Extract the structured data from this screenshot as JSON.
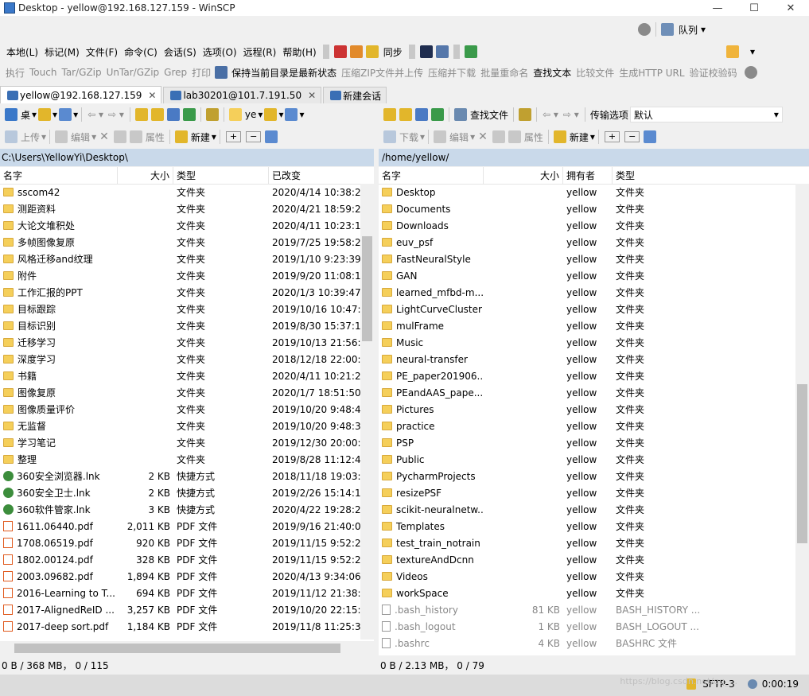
{
  "window": {
    "title": "Desktop - yellow@192.168.127.159 - WinSCP",
    "controls": [
      "—",
      "☐",
      "✕"
    ]
  },
  "top_toolbar": {
    "queue_label": "队列"
  },
  "menubar": {
    "items": [
      "本地(L)",
      "标记(M)",
      "文件(F)",
      "命令(C)",
      "会话(S)",
      "选项(O)",
      "远程(R)",
      "帮助(H)"
    ],
    "sync_label": "同步"
  },
  "commandbar": {
    "disabled_left": [
      "执行",
      "Touch",
      "Tar/GZip",
      "UnTar/GZip",
      "Grep",
      "打印"
    ],
    "keep_remote": "保持当前目录是最新状态",
    "disabled_mid": [
      "压缩ZIP文件并上传",
      "压缩并下载",
      "批量重命名"
    ],
    "find_text": "查找文本",
    "disabled_right": [
      "比较文件",
      "生成HTTP URL",
      "验证校验码"
    ]
  },
  "tabs": [
    {
      "label": "yellow@192.168.127.159",
      "close": "✕",
      "active": true
    },
    {
      "label": "lab30201@101.7.191.50",
      "close": "✕",
      "active": false
    },
    {
      "label": "新建会话",
      "close": "",
      "active": false
    }
  ],
  "local_toolbar": {
    "drive": "桌",
    "folder": "ye"
  },
  "remote_toolbar": {
    "find_files": "查找文件",
    "transfer_options": "传输选项",
    "transfer_value": "默认"
  },
  "local_actions": {
    "upload": "上传",
    "edit": "编辑",
    "props": "属性",
    "new": "新建"
  },
  "remote_actions": {
    "download": "下载",
    "edit": "编辑",
    "props": "属性",
    "new": "新建"
  },
  "local": {
    "path": "C:\\Users\\YellowYi\\Desktop\\",
    "headers": {
      "name": "名字",
      "size": "大小",
      "type": "类型",
      "modified": "已改变"
    },
    "rows": [
      {
        "icon": "folder",
        "name": "sscom42",
        "size": "",
        "type": "文件夹",
        "modified": "2020/4/14  10:38:2"
      },
      {
        "icon": "folder",
        "name": "测距资料",
        "size": "",
        "type": "文件夹",
        "modified": "2020/4/21  18:59:2"
      },
      {
        "icon": "folder",
        "name": "大论文堆积处",
        "size": "",
        "type": "文件夹",
        "modified": "2020/4/11  10:23:1"
      },
      {
        "icon": "folder",
        "name": "多帧图像复原",
        "size": "",
        "type": "文件夹",
        "modified": "2019/7/25  19:58:2"
      },
      {
        "icon": "folder",
        "name": "风格迁移and纹理",
        "size": "",
        "type": "文件夹",
        "modified": "2019/1/10  9:23:39"
      },
      {
        "icon": "folder",
        "name": "附件",
        "size": "",
        "type": "文件夹",
        "modified": "2019/9/20  11:08:1"
      },
      {
        "icon": "folder",
        "name": "工作汇报的PPT",
        "size": "",
        "type": "文件夹",
        "modified": "2020/1/3  10:39:47"
      },
      {
        "icon": "folder",
        "name": "目标跟踪",
        "size": "",
        "type": "文件夹",
        "modified": "2019/10/16  10:47:"
      },
      {
        "icon": "folder",
        "name": "目标识别",
        "size": "",
        "type": "文件夹",
        "modified": "2019/8/30  15:37:1"
      },
      {
        "icon": "folder",
        "name": "迁移学习",
        "size": "",
        "type": "文件夹",
        "modified": "2019/10/13  21:56:"
      },
      {
        "icon": "folder",
        "name": "深度学习",
        "size": "",
        "type": "文件夹",
        "modified": "2018/12/18  22:00:"
      },
      {
        "icon": "folder",
        "name": "书籍",
        "size": "",
        "type": "文件夹",
        "modified": "2020/4/11  10:21:2"
      },
      {
        "icon": "folder",
        "name": "图像复原",
        "size": "",
        "type": "文件夹",
        "modified": "2020/1/7  18:51:50"
      },
      {
        "icon": "folder",
        "name": "图像质量评价",
        "size": "",
        "type": "文件夹",
        "modified": "2019/10/20  9:48:4"
      },
      {
        "icon": "folder",
        "name": "无监督",
        "size": "",
        "type": "文件夹",
        "modified": "2019/10/20  9:48:3"
      },
      {
        "icon": "folder",
        "name": "学习笔记",
        "size": "",
        "type": "文件夹",
        "modified": "2019/12/30  20:00:"
      },
      {
        "icon": "folder",
        "name": "整理",
        "size": "",
        "type": "文件夹",
        "modified": "2019/8/28  11:12:4"
      },
      {
        "icon": "lnk",
        "name": "360安全浏览器.lnk",
        "size": "2 KB",
        "type": "快捷方式",
        "modified": "2018/11/18  19:03:"
      },
      {
        "icon": "lnk",
        "name": "360安全卫士.lnk",
        "size": "2 KB",
        "type": "快捷方式",
        "modified": "2019/2/26  15:14:1"
      },
      {
        "icon": "lnk",
        "name": "360软件管家.lnk",
        "size": "3 KB",
        "type": "快捷方式",
        "modified": "2020/4/22  19:28:2"
      },
      {
        "icon": "pdf",
        "name": "1611.06440.pdf",
        "size": "2,011 KB",
        "type": "PDF 文件",
        "modified": "2019/9/16  21:40:0"
      },
      {
        "icon": "pdf",
        "name": "1708.06519.pdf",
        "size": "920 KB",
        "type": "PDF 文件",
        "modified": "2019/11/15  9:52:2"
      },
      {
        "icon": "pdf",
        "name": "1802.00124.pdf",
        "size": "328 KB",
        "type": "PDF 文件",
        "modified": "2019/11/15  9:52:2"
      },
      {
        "icon": "pdf",
        "name": "2003.09682.pdf",
        "size": "1,894 KB",
        "type": "PDF 文件",
        "modified": "2020/4/13  9:34:06"
      },
      {
        "icon": "pdf",
        "name": "2016-Learning to T...",
        "size": "694 KB",
        "type": "PDF 文件",
        "modified": "2019/11/12  21:38:"
      },
      {
        "icon": "pdf",
        "name": "2017-AlignedReID ...",
        "size": "3,257 KB",
        "type": "PDF 文件",
        "modified": "2019/10/20  22:15:"
      },
      {
        "icon": "pdf",
        "name": "2017-deep sort.pdf",
        "size": "1,184 KB",
        "type": "PDF 文件",
        "modified": "2019/11/8  11:25:3"
      }
    ],
    "status": "0 B / 368 MB，  0 / 115"
  },
  "remote": {
    "path": "/home/yellow/",
    "headers": {
      "name": "名字",
      "size": "大小",
      "owner": "拥有者",
      "type": "类型"
    },
    "rows": [
      {
        "icon": "folder",
        "name": "Desktop",
        "size": "",
        "owner": "yellow",
        "type": "文件夹"
      },
      {
        "icon": "folder",
        "name": "Documents",
        "size": "",
        "owner": "yellow",
        "type": "文件夹"
      },
      {
        "icon": "folder",
        "name": "Downloads",
        "size": "",
        "owner": "yellow",
        "type": "文件夹"
      },
      {
        "icon": "folder",
        "name": "euv_psf",
        "size": "",
        "owner": "yellow",
        "type": "文件夹"
      },
      {
        "icon": "folder",
        "name": "FastNeuralStyle",
        "size": "",
        "owner": "yellow",
        "type": "文件夹"
      },
      {
        "icon": "folder",
        "name": "GAN",
        "size": "",
        "owner": "yellow",
        "type": "文件夹"
      },
      {
        "icon": "folder",
        "name": "learned_mfbd-m...",
        "size": "",
        "owner": "yellow",
        "type": "文件夹"
      },
      {
        "icon": "folder",
        "name": "LightCurveCluster",
        "size": "",
        "owner": "yellow",
        "type": "文件夹"
      },
      {
        "icon": "folder",
        "name": "mulFrame",
        "size": "",
        "owner": "yellow",
        "type": "文件夹"
      },
      {
        "icon": "folder",
        "name": "Music",
        "size": "",
        "owner": "yellow",
        "type": "文件夹"
      },
      {
        "icon": "folder",
        "name": "neural-transfer",
        "size": "",
        "owner": "yellow",
        "type": "文件夹"
      },
      {
        "icon": "folder",
        "name": "PE_paper201906...",
        "size": "",
        "owner": "yellow",
        "type": "文件夹"
      },
      {
        "icon": "folder",
        "name": "PEandAAS_pape...",
        "size": "",
        "owner": "yellow",
        "type": "文件夹"
      },
      {
        "icon": "folder",
        "name": "Pictures",
        "size": "",
        "owner": "yellow",
        "type": "文件夹"
      },
      {
        "icon": "folder",
        "name": "practice",
        "size": "",
        "owner": "yellow",
        "type": "文件夹"
      },
      {
        "icon": "folder",
        "name": "PSP",
        "size": "",
        "owner": "yellow",
        "type": "文件夹"
      },
      {
        "icon": "folder",
        "name": "Public",
        "size": "",
        "owner": "yellow",
        "type": "文件夹"
      },
      {
        "icon": "folder",
        "name": "PycharmProjects",
        "size": "",
        "owner": "yellow",
        "type": "文件夹"
      },
      {
        "icon": "folder",
        "name": "resizePSF",
        "size": "",
        "owner": "yellow",
        "type": "文件夹"
      },
      {
        "icon": "folder",
        "name": "scikit-neuralnetw...",
        "size": "",
        "owner": "yellow",
        "type": "文件夹"
      },
      {
        "icon": "folder",
        "name": "Templates",
        "size": "",
        "owner": "yellow",
        "type": "文件夹"
      },
      {
        "icon": "folder",
        "name": "test_train_notrain",
        "size": "",
        "owner": "yellow",
        "type": "文件夹"
      },
      {
        "icon": "folder",
        "name": "textureAndDcnn",
        "size": "",
        "owner": "yellow",
        "type": "文件夹"
      },
      {
        "icon": "folder",
        "name": "Videos",
        "size": "",
        "owner": "yellow",
        "type": "文件夹"
      },
      {
        "icon": "folder",
        "name": "workSpace",
        "size": "",
        "owner": "yellow",
        "type": "文件夹"
      },
      {
        "icon": "file",
        "name": ".bash_history",
        "size": "81 KB",
        "owner": "yellow",
        "type": "BASH_HISTORY ..."
      },
      {
        "icon": "file",
        "name": ".bash_logout",
        "size": "1 KB",
        "owner": "yellow",
        "type": "BASH_LOGOUT ..."
      },
      {
        "icon": "file",
        "name": ".bashrc",
        "size": "4 KB",
        "owner": "yellow",
        "type": "BASHRC 文件"
      }
    ],
    "status": "0 B / 2.13 MB，  0 / 79"
  },
  "statusbar": {
    "protocol": "SFTP-3",
    "timer": "0:00:19"
  },
  "watermark": "https://blog.csdn.net/qq_..."
}
